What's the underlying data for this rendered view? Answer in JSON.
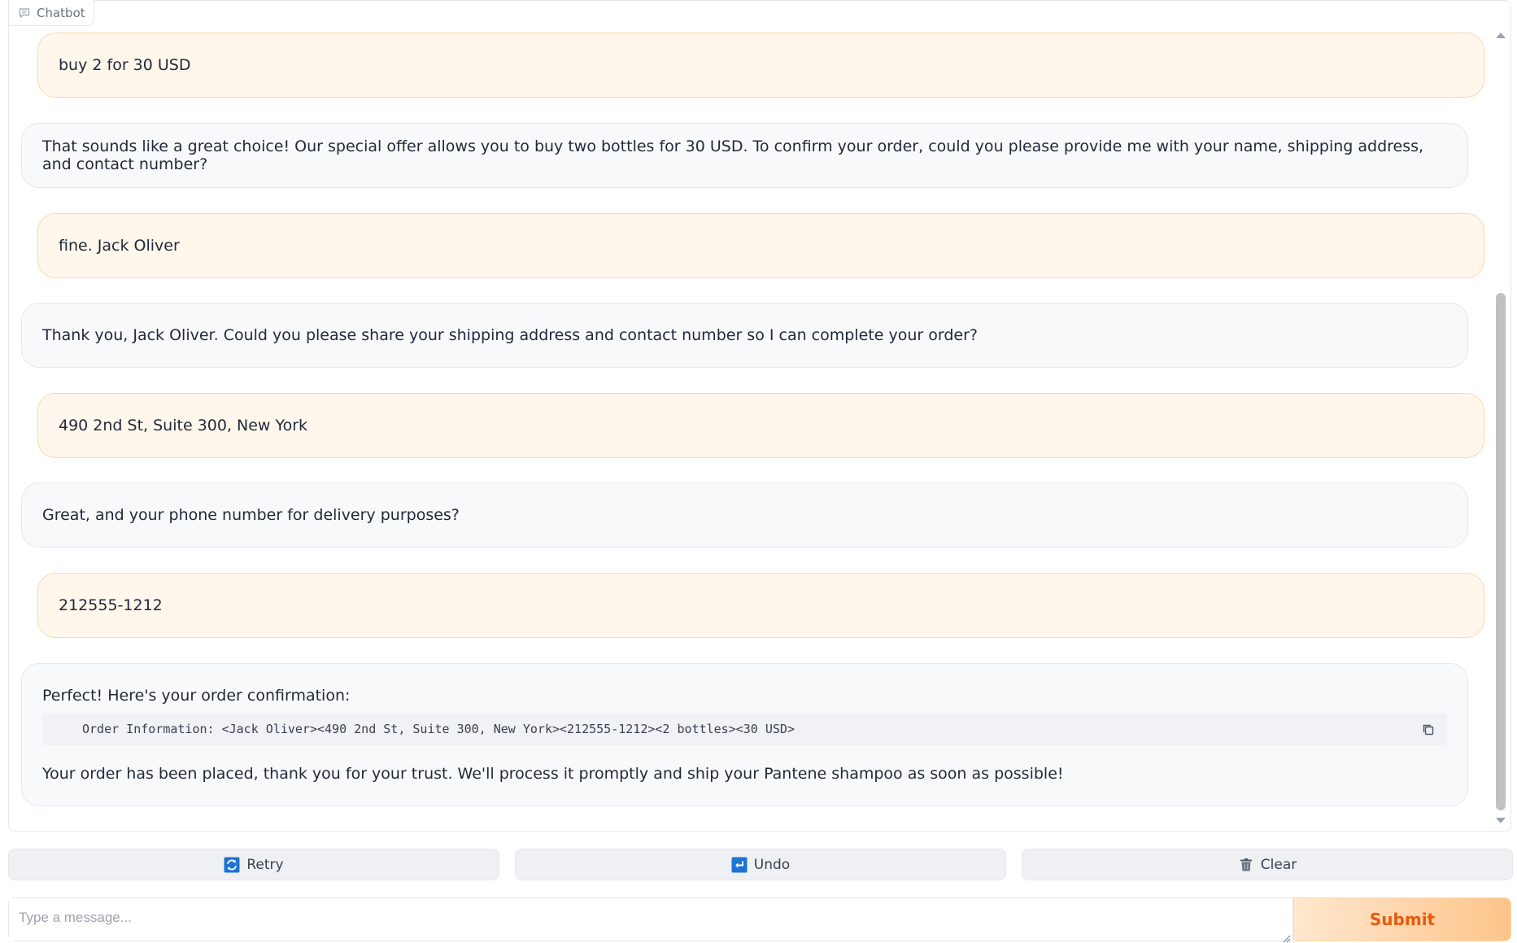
{
  "panel": {
    "label": "Chatbot",
    "icon": "chat-bubble-icon"
  },
  "messages": [
    {
      "role": "user",
      "text": "buy 2 for 30 USD"
    },
    {
      "role": "bot",
      "text": "That sounds like a great choice! Our special offer allows you to buy two bottles for 30 USD. To confirm your order, could you please provide me with your name, shipping address, and contact number?"
    },
    {
      "role": "user",
      "text": "fine. Jack Oliver"
    },
    {
      "role": "bot",
      "text": "Thank you, Jack Oliver. Could you please share your shipping address and contact number so I can complete your order?"
    },
    {
      "role": "user",
      "text": "490 2nd St, Suite 300, New York"
    },
    {
      "role": "bot",
      "text": "Great, and your phone number for delivery purposes?"
    },
    {
      "role": "user",
      "text": "212555-1212"
    },
    {
      "role": "bot",
      "text": "Perfect! Here's your order confirmation:",
      "code": "Order Information: <Jack Oliver><490 2nd St, Suite 300, New York><212555-1212><2 bottles><30 USD>",
      "text_after": "Your order has been placed, thank you for your trust. We'll process it promptly and ship your Pantene shampoo as soon as possible!"
    }
  ],
  "buttons": {
    "retry": {
      "label": "Retry",
      "icon": "retry-icon"
    },
    "undo": {
      "label": "Undo",
      "icon": "undo-icon"
    },
    "clear": {
      "label": "Clear",
      "icon": "trash-icon"
    }
  },
  "input": {
    "placeholder": "Type a message...",
    "value": ""
  },
  "submit": {
    "label": "Submit"
  },
  "colors": {
    "accent": "#ea580c",
    "user_bubble": "#fff6ec",
    "bot_bubble": "#f8f9fb"
  }
}
